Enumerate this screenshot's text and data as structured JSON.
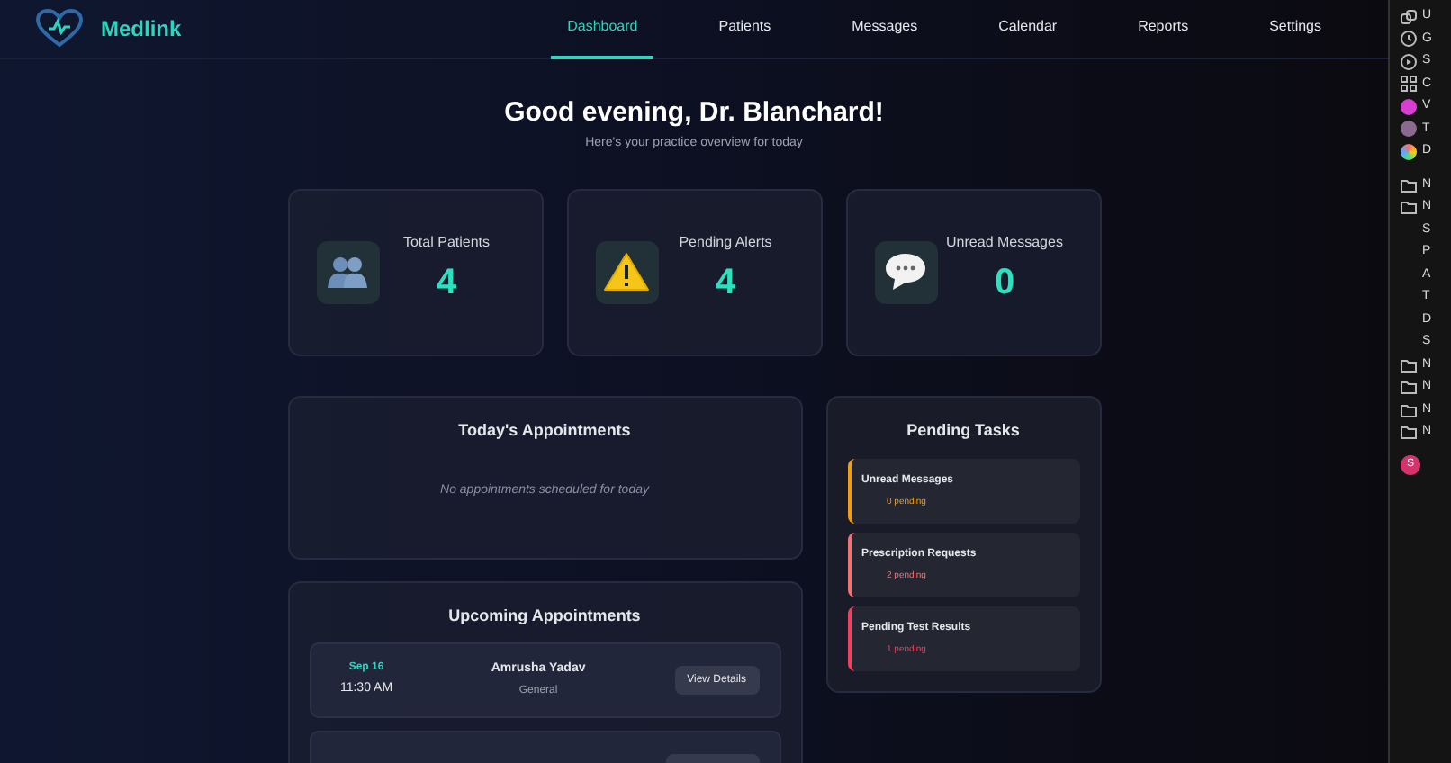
{
  "brand": {
    "name": "Medlink"
  },
  "nav": [
    {
      "label": "Dashboard",
      "selected": true
    },
    {
      "label": "Patients",
      "selected": false
    },
    {
      "label": "Messages",
      "selected": false
    },
    {
      "label": "Calendar",
      "selected": false
    },
    {
      "label": "Reports",
      "selected": false
    },
    {
      "label": "Settings",
      "selected": false
    }
  ],
  "greeting": {
    "title": "Good evening, Dr. Blanchard!",
    "subtitle": "Here's your practice overview for today"
  },
  "stats": [
    {
      "kind": "patients",
      "label": "Total Patients",
      "value": "4"
    },
    {
      "kind": "alerts",
      "label": "Pending Alerts",
      "value": "4"
    },
    {
      "kind": "messages",
      "label": "Unread Messages",
      "value": "0"
    }
  ],
  "today": {
    "title": "Today's Appointments",
    "empty_text": "No appointments scheduled for today"
  },
  "upcoming": {
    "title": "Upcoming Appointments",
    "rows": [
      {
        "date": "Sep 16",
        "time": "11:30 AM",
        "patient": "Amrusha Yadav",
        "type": "General",
        "action": "View Details"
      }
    ]
  },
  "tasks": {
    "title": "Pending Tasks",
    "items": [
      {
        "label": "Unread Messages",
        "count": "0 pending",
        "color": "#f59e0b"
      },
      {
        "label": "Prescription Requests",
        "count": "2 pending",
        "color": "#f87171"
      },
      {
        "label": "Pending Test Results",
        "count": "1 pending",
        "color": "#f43f5e"
      }
    ]
  },
  "side_panel": {
    "items": [
      {
        "kind": "link",
        "text": "U"
      },
      {
        "kind": "clock",
        "text": "G"
      },
      {
        "kind": "play",
        "text": "S"
      },
      {
        "kind": "grid",
        "text": "C"
      },
      {
        "kind": "pink",
        "text": "V"
      },
      {
        "kind": "avatar",
        "text": "T"
      },
      {
        "kind": "rainbow",
        "text": "D"
      },
      {
        "kind": "gap"
      },
      {
        "kind": "folder",
        "text": "N"
      },
      {
        "kind": "folder",
        "text": "N"
      },
      {
        "kind": "text",
        "text": "S"
      },
      {
        "kind": "text",
        "text": "P"
      },
      {
        "kind": "text",
        "text": "A"
      },
      {
        "kind": "text",
        "text": "T"
      },
      {
        "kind": "text",
        "text": "D"
      },
      {
        "kind": "text",
        "text": "S"
      },
      {
        "kind": "folder",
        "text": "N"
      },
      {
        "kind": "folder",
        "text": "N"
      },
      {
        "kind": "folder",
        "text": "N"
      },
      {
        "kind": "folder",
        "text": "N"
      }
    ],
    "profile_initial": "S"
  }
}
